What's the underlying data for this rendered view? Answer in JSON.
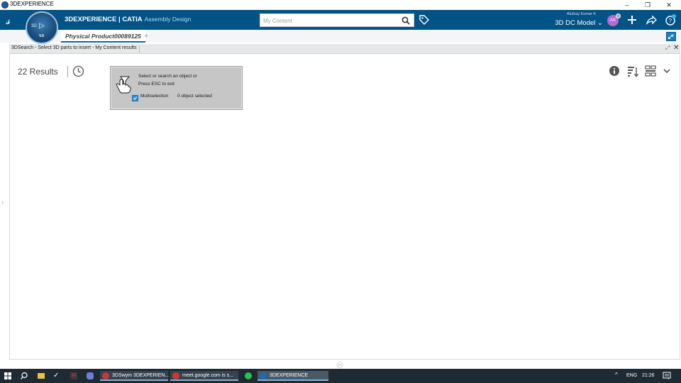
{
  "window": {
    "title": "3DEXPERIENCE",
    "minimize": "–",
    "restore": "❐",
    "close": "✕"
  },
  "topbar": {
    "compass_version": "V.6",
    "compass_label_3d": "3D",
    "brand_strong": "3DEXPERIENCE | CATIA",
    "brand_app": "Assembly Design",
    "search_placeholder": "My Content",
    "user_name": "Akshay Kumar K",
    "model_name": "3D DC Model",
    "avatar_initials": "AK"
  },
  "tabs": {
    "active": "Physical Product00089125",
    "add": "+"
  },
  "panel": {
    "title": "3DSearch - Select 3D parts to insert - My Content results",
    "expand": "⤢",
    "close": "✕"
  },
  "results": {
    "count_label": "22 Results"
  },
  "selection": {
    "line1": "Select or search an object or",
    "line2": "Press ESC to exit",
    "multiselection_label": "Multiselection",
    "multiselection_checked": true,
    "selected_count": "0 object selected"
  },
  "taskbar": {
    "items": [
      {
        "label": "3DSwym 3DEXPERIEN...",
        "color": "#c43a3a"
      },
      {
        "label": "meet.google.com is s...",
        "color": "#c43a3a"
      },
      {
        "label": "3DEXPERIENCE",
        "color": "#1e6bb0"
      }
    ],
    "lang": "ENG",
    "time": "21:26"
  },
  "icons": {
    "search": "search-icon",
    "tag": "tag-icon",
    "add": "plus-icon",
    "share": "share-icon",
    "help": "help-icon",
    "history": "clock-icon",
    "info": "info-icon",
    "sort": "sort-icon",
    "grid": "grid-view-icon",
    "chevron": "chevron-down-icon",
    "hand": "hand-pointer-icon"
  }
}
